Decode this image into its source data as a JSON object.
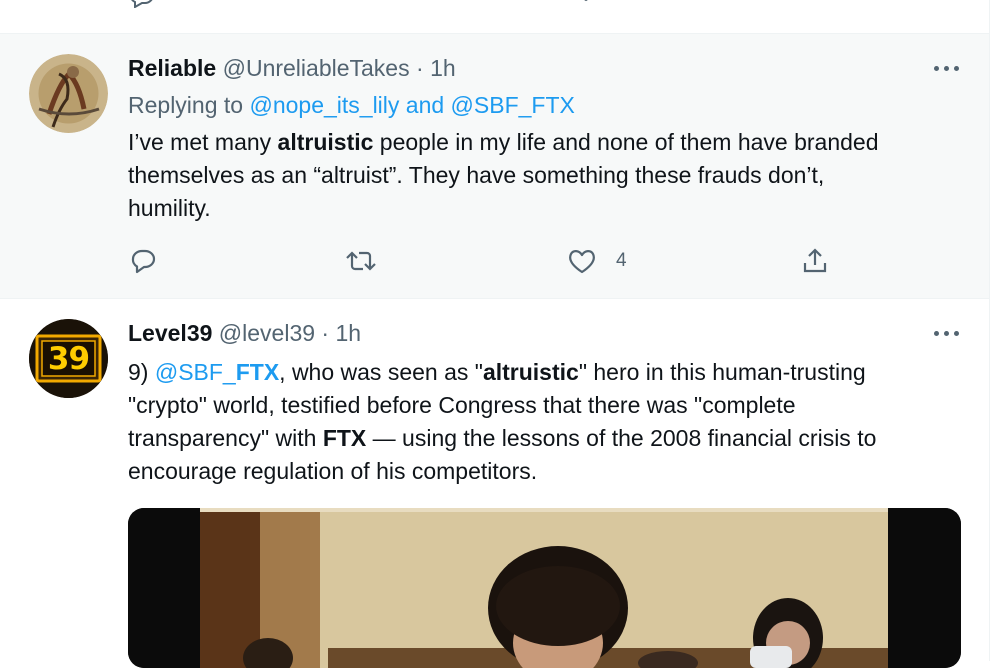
{
  "tweets": [
    {
      "name": "Reliable",
      "handle": "@UnreliableTakes",
      "separator": "·",
      "time": "1h",
      "replying_to_prefix": "Replying to",
      "replying_to_mentions": "@nope_its_lily and @SBF_FTX",
      "text_segments": {
        "l1a": "I’ve met many ",
        "l1b": "altruistic",
        "l1c": " people in my life and none of them have branded",
        "l2": "themselves as an “altruist”. They have something these frauds don’t,",
        "l3": "humility."
      },
      "actions": {
        "reply_count": "",
        "retweet_count": "",
        "like_count": "4"
      }
    },
    {
      "name": "Level39",
      "handle": "@level39",
      "separator": "·",
      "time": "1h",
      "avatar_text": "39",
      "text_segments": {
        "l1a": "9) ",
        "l1b": "@SBF_",
        "l1c": "FTX",
        "l1d": ", who was seen as \"",
        "l1e": "altruistic",
        "l1f": "\" hero in this human-trusting",
        "l2": "\"crypto\" world, testified before Congress that there was \"complete",
        "l3a": "transparency\" with ",
        "l3b": "FTX",
        "l3c": " — using the lessons of the 2008 financial crisis to",
        "l4": "encourage regulation of his competitors."
      }
    }
  ],
  "colors": {
    "accent": "#1d9bf0",
    "muted": "#536471",
    "text": "#0f1419",
    "highlight_bg": "#f7f9f9"
  },
  "icons": [
    "reply-icon",
    "retweet-icon",
    "like-icon",
    "share-icon",
    "more-icon"
  ]
}
